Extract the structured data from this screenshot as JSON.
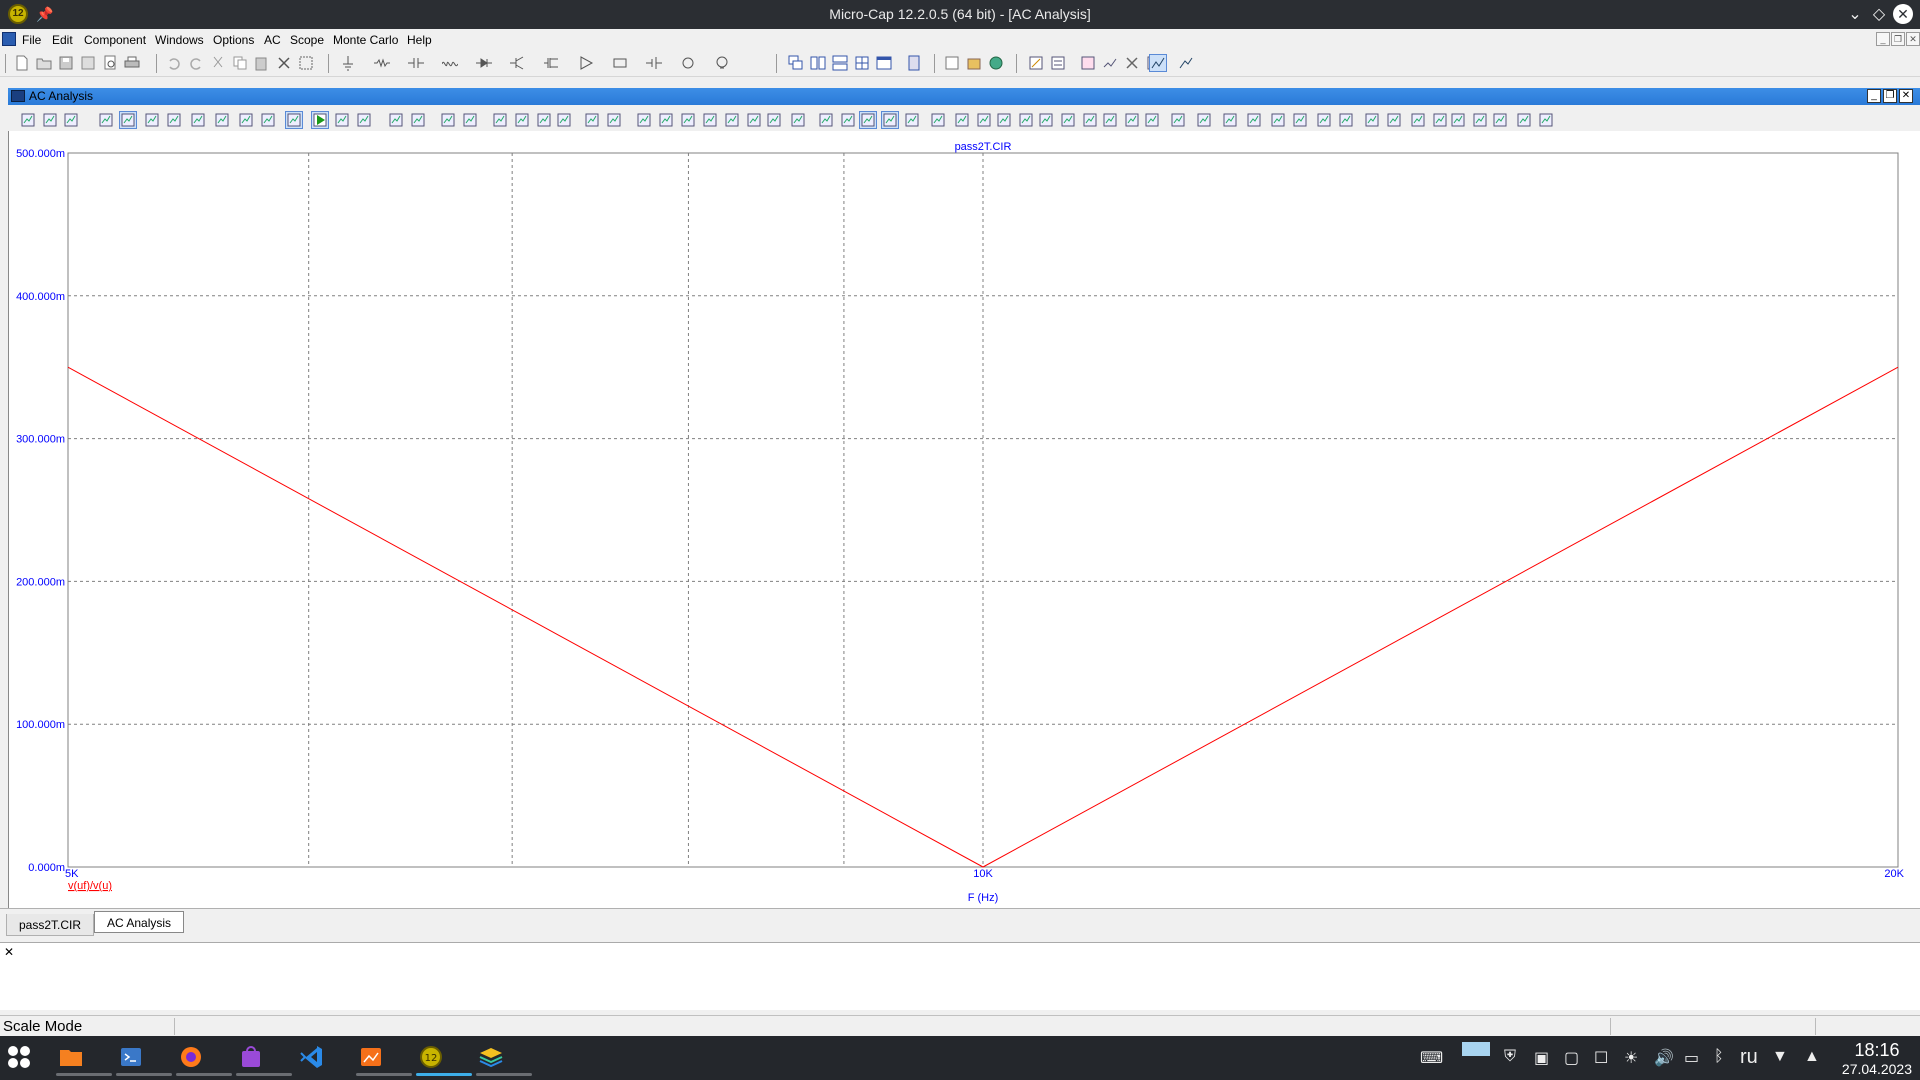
{
  "window": {
    "title": "Micro-Cap 12.2.0.5 (64 bit) - [AC Analysis]"
  },
  "menu": [
    "File",
    "Edit",
    "Component",
    "Windows",
    "Options",
    "AC",
    "Scope",
    "Monte Carlo",
    "Help"
  ],
  "child_window": {
    "title": "AC Analysis"
  },
  "chart_data": {
    "type": "line",
    "title": "pass2T.CIR",
    "xlabel": "F (Hz)",
    "x_scale": "log",
    "xlim": [
      5000,
      20000
    ],
    "x_tick_labels": [
      "5K",
      "10K",
      "20K"
    ],
    "ylim": [
      0,
      0.5
    ],
    "y_tick_labels": [
      "500.000m",
      "400.000m",
      "300.000m",
      "200.000m",
      "100.000m",
      "0.000m"
    ],
    "grid": true,
    "series": [
      {
        "name": "v(uf)/v(u)",
        "color": "#ff0000",
        "x": [
          5000,
          7071,
          10000,
          14142,
          20000
        ],
        "y": [
          0.35,
          0.175,
          0.0,
          0.175,
          0.35
        ]
      }
    ]
  },
  "tabs": [
    {
      "label": "pass2T.CIR",
      "active": false
    },
    {
      "label": "AC Analysis",
      "active": true
    }
  ],
  "status": {
    "mode": "Scale Mode"
  },
  "taskbar": {
    "language": "ru",
    "time": "18:16",
    "date": "27.04.2023",
    "apps": [
      "file-manager-icon",
      "terminal-icon",
      "firefox-icon",
      "store-icon",
      "vscode-icon",
      "image-viewer-icon",
      "microcap-icon",
      "layers-icon"
    ]
  }
}
